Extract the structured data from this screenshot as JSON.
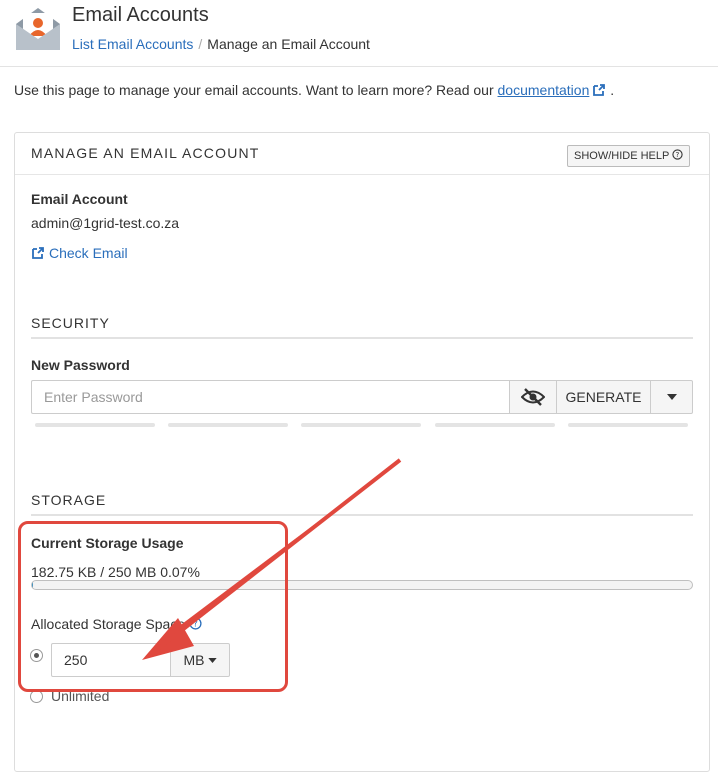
{
  "header": {
    "title": "Email Accounts",
    "breadcrumb": {
      "link": "List Email Accounts",
      "separator": "/",
      "current": "Manage an Email Account"
    }
  },
  "intro": {
    "text": "Use this page to manage your email accounts. Want to learn more? Read our ",
    "link": "documentation",
    "suffix": "."
  },
  "panel": {
    "title": "MANAGE AN EMAIL ACCOUNT",
    "help_button": "SHOW/HIDE HELP",
    "email_label": "Email Account",
    "email_value": "admin@1grid-test.co.za",
    "check_email": "Check Email"
  },
  "security": {
    "heading": "SECURITY",
    "password_label": "New Password",
    "password_placeholder": "Enter Password",
    "generate_label": "GENERATE"
  },
  "storage": {
    "heading": "STORAGE",
    "current_label": "Current Storage Usage",
    "usage_text": "182.75 KB / 250 MB 0.07%",
    "usage_percent": 0.07,
    "allocated_label": "Allocated Storage Space",
    "quota_value": "250",
    "unit": "MB",
    "unlimited_label": "Unlimited"
  },
  "colors": {
    "accent": "#2a6ebb",
    "highlight": "#e0483e",
    "icon_orange": "#e8662b"
  }
}
